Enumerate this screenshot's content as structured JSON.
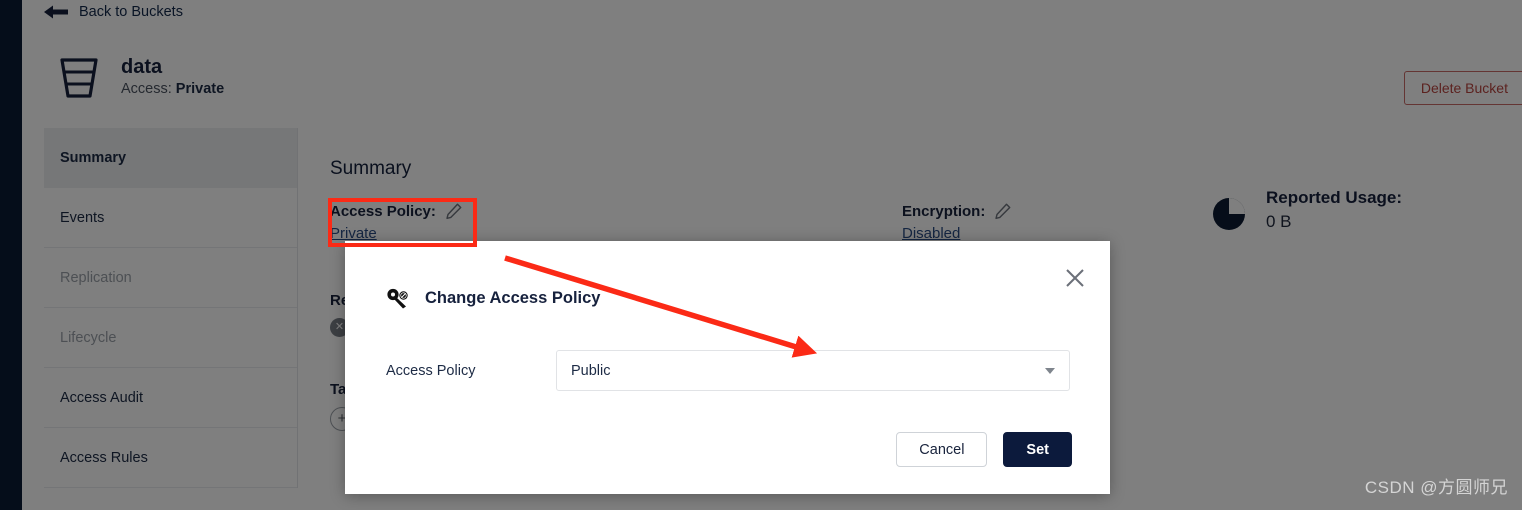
{
  "nav": {
    "back_label": "Back to Buckets",
    "back_icon": "arrow-left-icon"
  },
  "bucket": {
    "icon": "bucket-icon",
    "name": "data",
    "access_prefix": "Access:",
    "access_value": "Private",
    "delete_label": "Delete Bucket"
  },
  "tabs": [
    {
      "label": "Summary",
      "active": true,
      "disabled": false
    },
    {
      "label": "Events",
      "active": false,
      "disabled": false
    },
    {
      "label": "Replication",
      "active": false,
      "disabled": true
    },
    {
      "label": "Lifecycle",
      "active": false,
      "disabled": true
    },
    {
      "label": "Access Audit",
      "active": false,
      "disabled": false
    },
    {
      "label": "Access Rules",
      "active": false,
      "disabled": false
    }
  ],
  "summary": {
    "title": "Summary",
    "access_policy_label": "Access Policy:",
    "access_policy_value": "Private",
    "access_policy_edit_icon": "pencil-icon",
    "encryption_label": "Encryption:",
    "encryption_value": "Disabled",
    "encryption_edit_icon": "pencil-icon",
    "usage_icon": "pie-chart-icon",
    "usage_label": "Reported Usage:",
    "usage_value": "0 B",
    "replication_label": "Re",
    "replication_status_icon": "x-circle-icon",
    "tags_label": "Ta",
    "tags_add_icon": "plus-circle-icon"
  },
  "modal": {
    "title": "Change Access Policy",
    "title_icon": "key-icon",
    "close_icon": "close-icon",
    "field_label": "Access Policy",
    "field_value": "Public",
    "field_caret_icon": "chevron-down-icon",
    "cancel_label": "Cancel",
    "set_label": "Set"
  },
  "annotation": {
    "highlight_color": "#fb2a16"
  },
  "watermark": {
    "text": "CSDN @方圆师兄"
  }
}
